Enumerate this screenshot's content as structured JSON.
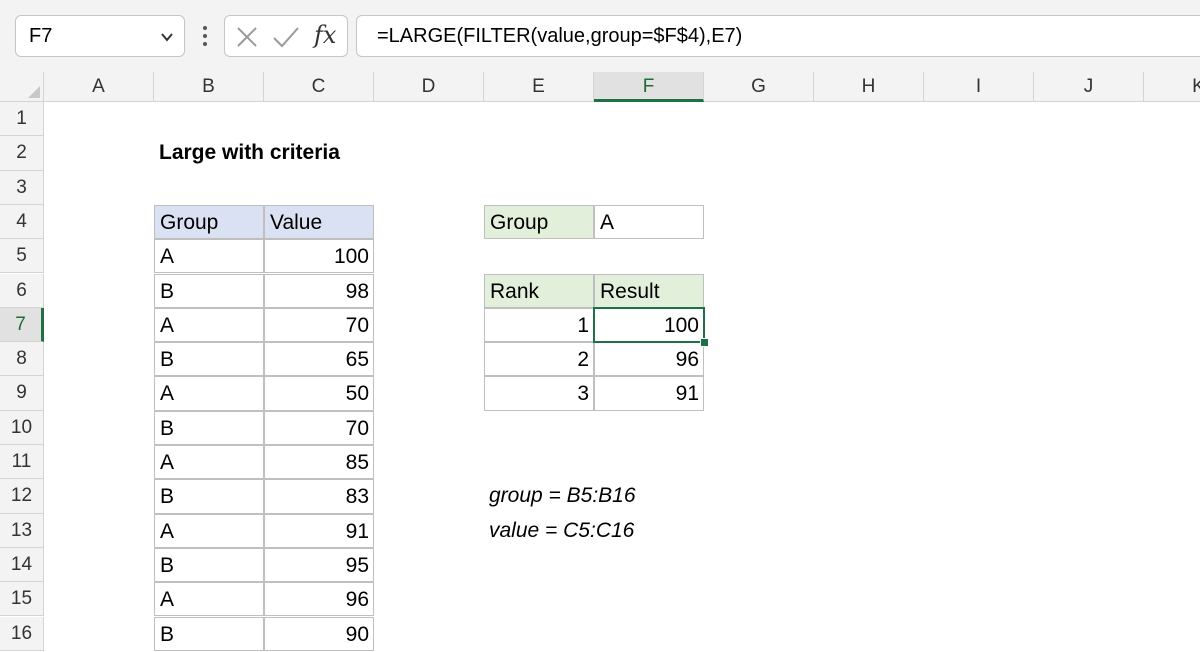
{
  "formula_bar": {
    "name_box": "F7",
    "formula": "=LARGE(FILTER(value,group=$F$4),E7)",
    "fx_label": "fx"
  },
  "columns": [
    "A",
    "B",
    "C",
    "D",
    "E",
    "F",
    "G",
    "H",
    "I",
    "J",
    "K"
  ],
  "rows": [
    "1",
    "2",
    "3",
    "4",
    "5",
    "6",
    "7",
    "8",
    "9",
    "10",
    "11",
    "12",
    "13",
    "14",
    "15",
    "16"
  ],
  "active": {
    "column": "F",
    "row": "7"
  },
  "sheet": {
    "title": "Large with criteria",
    "data_table": {
      "headers": [
        "Group",
        "Value"
      ],
      "rows": [
        [
          "A",
          "100"
        ],
        [
          "B",
          "98"
        ],
        [
          "A",
          "70"
        ],
        [
          "B",
          "65"
        ],
        [
          "A",
          "50"
        ],
        [
          "B",
          "70"
        ],
        [
          "A",
          "85"
        ],
        [
          "B",
          "83"
        ],
        [
          "A",
          "91"
        ],
        [
          "B",
          "95"
        ],
        [
          "A",
          "96"
        ],
        [
          "B",
          "90"
        ]
      ]
    },
    "criteria": {
      "label": "Group",
      "value": "A"
    },
    "result_table": {
      "headers": [
        "Rank",
        "Result"
      ],
      "rows": [
        [
          "1",
          "100"
        ],
        [
          "2",
          "96"
        ],
        [
          "3",
          "91"
        ]
      ]
    },
    "named_ranges": [
      "group = B5:B16",
      "value = C5:C16"
    ]
  },
  "colors": {
    "accent": "#1e7145",
    "header_blue": "#d9e1f2",
    "header_green": "#e2efda"
  }
}
